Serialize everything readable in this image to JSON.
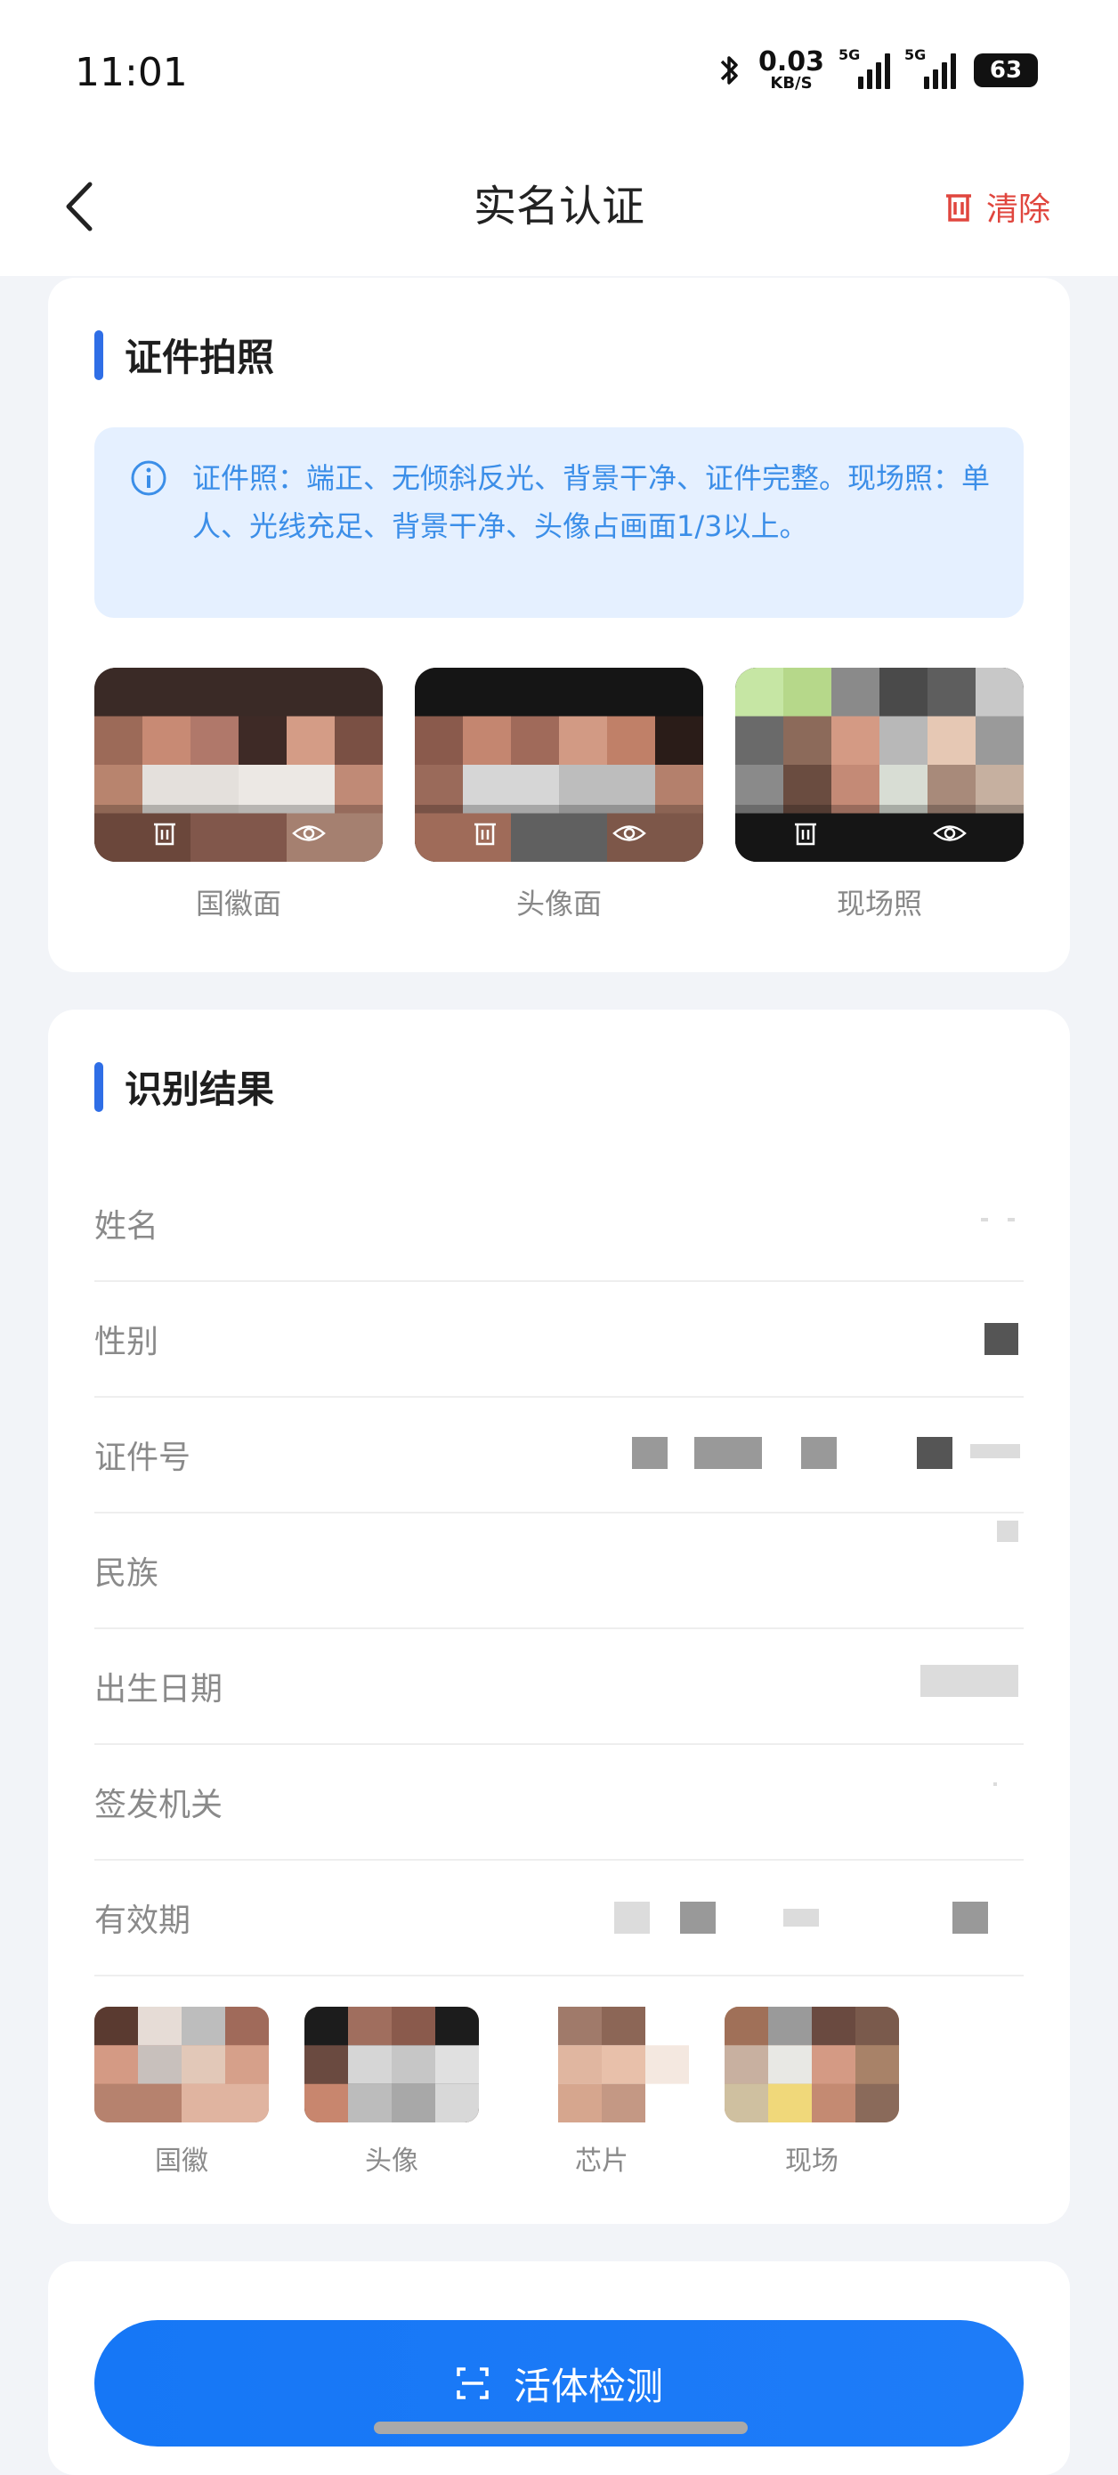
{
  "status_bar": {
    "time": "11:01",
    "net_speed_value": "0.03",
    "net_speed_unit": "KB/S",
    "signal1_label": "5G",
    "signal2_label": "5G",
    "battery": "63"
  },
  "nav": {
    "title": "实名认证",
    "clear_label": "清除"
  },
  "photo_section": {
    "title": "证件拍照",
    "notice": "证件照：端正、无倾斜反光、背景干净、证件完整。现场照：单人、光线充足、背景干净、头像占画面1/3以上。",
    "tiles": [
      {
        "label": "国徽面"
      },
      {
        "label": "头像面"
      },
      {
        "label": "现场照"
      }
    ]
  },
  "result_section": {
    "title": "识别结果",
    "fields": [
      {
        "label": "姓名"
      },
      {
        "label": "性别"
      },
      {
        "label": "证件号"
      },
      {
        "label": "民族"
      },
      {
        "label": "出生日期"
      },
      {
        "label": "签发机关"
      },
      {
        "label": "有效期"
      }
    ],
    "faces": [
      {
        "label": "国徽"
      },
      {
        "label": "头像"
      },
      {
        "label": "芯片"
      },
      {
        "label": "现场"
      }
    ]
  },
  "actions": {
    "liveness_label": "活体检测"
  }
}
